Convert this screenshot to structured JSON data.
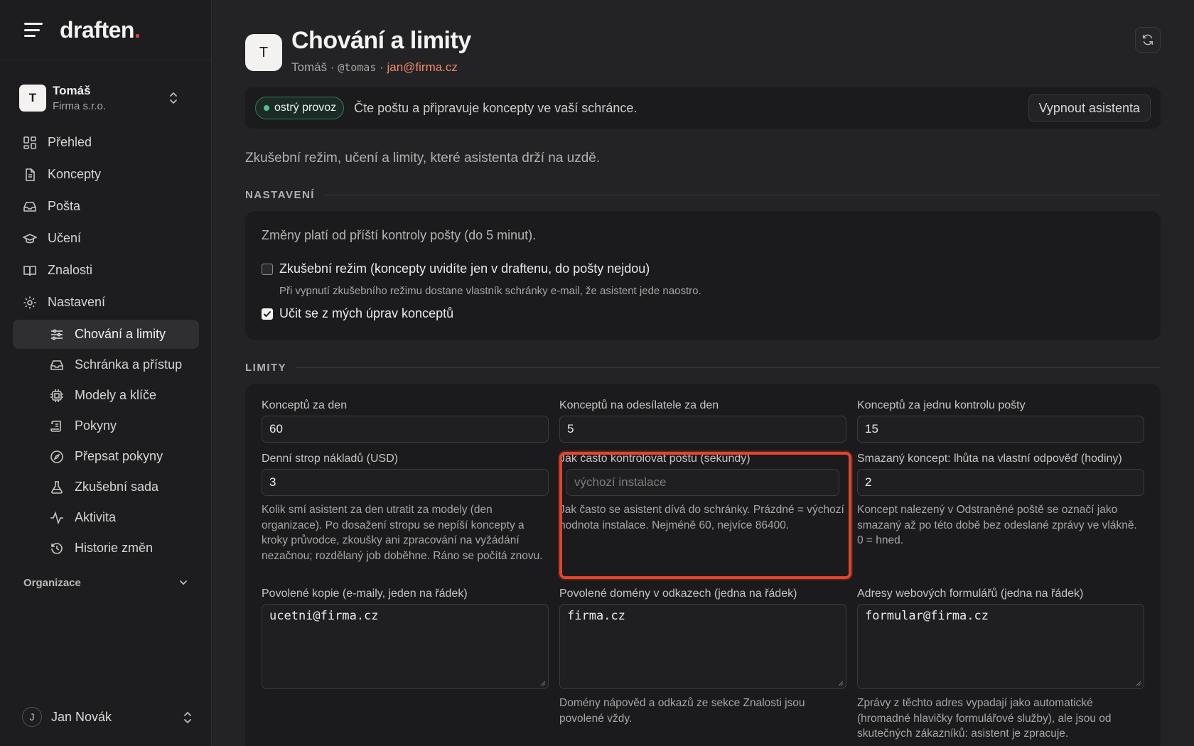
{
  "brand": {
    "name": "draften",
    "dot": "."
  },
  "account": {
    "initial": "T",
    "name": "Tomáš",
    "org": "Firma s.r.o."
  },
  "nav": {
    "items": [
      {
        "label": "Přehled",
        "icon": "grid-icon"
      },
      {
        "label": "Koncepty",
        "icon": "file-icon"
      },
      {
        "label": "Pošta",
        "icon": "inbox-icon"
      },
      {
        "label": "Učení",
        "icon": "graduation-cap-icon"
      },
      {
        "label": "Znalosti",
        "icon": "book-icon"
      },
      {
        "label": "Nastavení",
        "icon": "gear-icon"
      }
    ],
    "sub_items": [
      {
        "label": "Chování a limity",
        "icon": "sliders-icon",
        "active": true
      },
      {
        "label": "Schránka a přístup",
        "icon": "inbox-icon"
      },
      {
        "label": "Modely a klíče",
        "icon": "chip-icon"
      },
      {
        "label": "Pokyny",
        "icon": "scroll-icon"
      },
      {
        "label": "Přepsat pokyny",
        "icon": "compass-icon"
      },
      {
        "label": "Zkušební sada",
        "icon": "flask-icon"
      },
      {
        "label": "Aktivita",
        "icon": "activity-icon"
      },
      {
        "label": "Historie změn",
        "icon": "history-icon"
      }
    ],
    "org_group": "Organizace"
  },
  "user": {
    "initial": "J",
    "name": "Jan Novák"
  },
  "header": {
    "initial": "T",
    "title": "Chování a limity",
    "name": "Tomáš",
    "sep": " · ",
    "handle": "@tomas",
    "email": "jan@firma.cz"
  },
  "status": {
    "badge": "ostrý provoz",
    "text": "Čte poštu a připravuje koncepty ve vaší schránce.",
    "off_button": "Vypnout asistenta",
    "badge_color": "#4bc48f"
  },
  "intro": "Zkušební režim, učení a limity, které asistenta drží na uzdě.",
  "settings": {
    "section": "NASTAVENÍ",
    "note": "Změny platí od příští kontroly pošty (do 5 minut).",
    "trial_mode": {
      "label": "Zkušební režim (koncepty uvidíte jen v draftenu, do pošty nejdou)",
      "checked": false,
      "hint": "Při vypnutí zkušebního režimu dostane vlastník schránky e-mail, že asistent jede naostro."
    },
    "learn": {
      "label": "Učit se z mých úprav konceptů",
      "checked": true
    }
  },
  "limits": {
    "section": "LIMITY",
    "drafts_per_day": {
      "label": "Konceptů za den",
      "value": "60"
    },
    "drafts_per_sender": {
      "label": "Konceptů na odesílatele za den",
      "value": "5"
    },
    "drafts_per_check": {
      "label": "Konceptů za jednu kontrolu pošty",
      "value": "15"
    },
    "cost_cap": {
      "label": "Denní strop nákladů (USD)",
      "value": "3",
      "help": "Kolik smí asistent za den utratit za modely (den organizace). Po dosažení stropu se nepíší koncepty a kroky průvodce, zkoušky ani zpracování na vyžádání nezačnou; rozdělaný job doběhne. Ráno se počítá znovu."
    },
    "poll_interval": {
      "label": "Jak často kontrolovat poštu (sekundy)",
      "value": "",
      "placeholder": "výchozí instalace",
      "help": "Jak často se asistent dívá do schránky. Prázdné = výchozí hodnota instalace. Nejméně 60, nejvíce 86400."
    },
    "deleted_grace": {
      "label": "Smazaný koncept: lhůta na vlastní odpověď (hodiny)",
      "value": "2",
      "help": "Koncept nalezený v Odstraněné poště se označí jako smazaný až po této době bez odeslané zprávy ve vlákně. 0 = hned."
    },
    "allowed_cc": {
      "label": "Povolené kopie (e-maily, jeden na řádek)",
      "value": "ucetni@firma.cz"
    },
    "allowed_domains": {
      "label": "Povolené domény v odkazech (jedna na řádek)",
      "value": "firma.cz",
      "help": "Domény nápověd a odkazů ze sekce Znalosti jsou povolené vždy."
    },
    "web_forms": {
      "label": "Adresy webových formulářů (jedna na řádek)",
      "value": "formular@firma.cz",
      "help": "Zprávy z těchto adres vypadají jako automatické (hromadné hlavičky formulářové služby), ale jsou od skutečných zákazníků: asistent je zpracuje."
    }
  }
}
